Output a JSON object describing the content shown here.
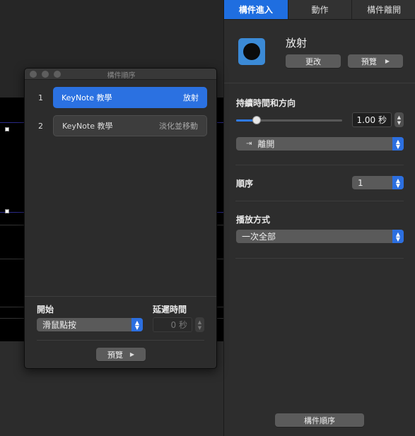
{
  "inspector": {
    "tabs": [
      {
        "label": "構件進入",
        "active": true
      },
      {
        "label": "動作",
        "active": false
      },
      {
        "label": "構件離開",
        "active": false
      }
    ],
    "effect": {
      "name": "放射",
      "change_button": "更改",
      "preview_button": "預覽",
      "preview_icon": "play-icon"
    },
    "duration": {
      "label": "持續時間和方向",
      "value": "1.00 秒",
      "slider_fraction": 0.19,
      "direction": "離開",
      "direction_icon": "exit-arrow-icon"
    },
    "order": {
      "label": "順序",
      "value": "1"
    },
    "delivery": {
      "label": "播放方式",
      "value": "一次全部"
    },
    "build_order_button": "構件順序"
  },
  "build_order_window": {
    "title": "構件順序",
    "items": [
      {
        "index": "1",
        "name": "KeyNote 教學",
        "effect": "放射",
        "selected": true
      },
      {
        "index": "2",
        "name": "KeyNote 教學",
        "effect": "淡化並移動",
        "selected": false
      }
    ],
    "start": {
      "label": "開始",
      "value": "滑鼠點按"
    },
    "delay": {
      "label": "延遲時間",
      "value": "0 秒"
    },
    "preview_button": "預覽"
  },
  "colors": {
    "accent": "#2b71e1",
    "effect_icon": "#3b8ad6"
  }
}
